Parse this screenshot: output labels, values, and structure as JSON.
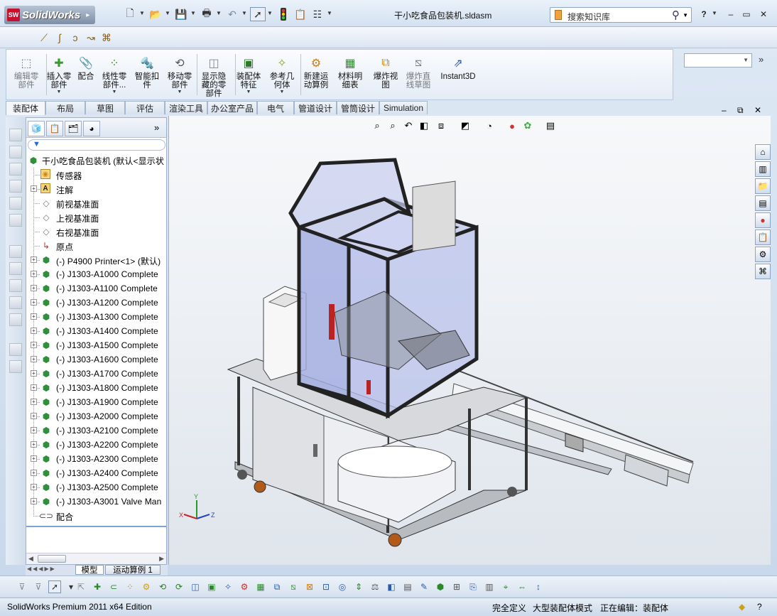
{
  "app": {
    "logo_text": "SolidWorks",
    "logo_badge": "SW",
    "document_title": "干小吃食品包装机.sldasm",
    "search_placeholder": "搜索知识库"
  },
  "quick_toolbar": {
    "icons": [
      "new-document-icon",
      "open-folder-icon",
      "save-icon",
      "print-icon",
      "undo-icon",
      "select-arrow-icon",
      "rebuild-traffic-light-icon",
      "options-icon",
      "file-properties-icon"
    ]
  },
  "window_controls": {
    "help": "?",
    "minimize": "–",
    "restore": "▭",
    "close": "✕"
  },
  "command_manager": {
    "buttons": [
      {
        "label": "编辑零\n部件",
        "icon": "edit-component-icon",
        "enabled": false
      },
      {
        "label": "插入零\n部件",
        "icon": "insert-component-icon",
        "enabled": true,
        "dropdown": true
      },
      {
        "label": "配合",
        "icon": "mate-icon",
        "enabled": true
      },
      {
        "label": "线性零\n部件...",
        "icon": "linear-pattern-icon",
        "enabled": true,
        "dropdown": true
      },
      {
        "label": "智能扣\n件",
        "icon": "smart-fastener-icon",
        "enabled": true
      },
      {
        "label": "移动零\n部件",
        "icon": "move-component-icon",
        "enabled": true,
        "dropdown": true
      },
      {
        "label": "显示隐\n藏的零\n部件",
        "icon": "show-hidden-icon",
        "enabled": true
      },
      {
        "label": "装配体\n特征",
        "icon": "assembly-feature-icon",
        "enabled": true,
        "dropdown": true
      },
      {
        "label": "参考几\n何体",
        "icon": "reference-geometry-icon",
        "enabled": true,
        "dropdown": true
      },
      {
        "label": "新建运\n动算例",
        "icon": "new-motion-study-icon",
        "enabled": true
      },
      {
        "label": "材料明\n细表",
        "icon": "bill-of-materials-icon",
        "enabled": true
      },
      {
        "label": "爆炸视\n图",
        "icon": "exploded-view-icon",
        "enabled": true
      },
      {
        "label": "爆炸直\n线草图",
        "icon": "explode-line-sketch-icon",
        "enabled": false
      },
      {
        "label": "Instant3D",
        "icon": "instant3d-icon",
        "enabled": true
      }
    ]
  },
  "tabs": [
    "装配体",
    "布局",
    "草图",
    "评估",
    "渲染工具",
    "办公室产品",
    "电气",
    "管道设计",
    "管筒设计",
    "Simulation"
  ],
  "active_tab": "装配体",
  "tree": {
    "root": "干小吃食品包装机  (默认<显示状",
    "items": [
      {
        "text": "传感器",
        "icon": "sensor-icon",
        "expandable": false
      },
      {
        "text": "注解",
        "icon": "annotation-icon",
        "expandable": true
      },
      {
        "text": "前视基准面",
        "icon": "plane-icon",
        "expandable": false
      },
      {
        "text": "上视基准面",
        "icon": "plane-icon",
        "expandable": false
      },
      {
        "text": "右视基准面",
        "icon": "plane-icon",
        "expandable": false
      },
      {
        "text": "原点",
        "icon": "origin-icon",
        "expandable": false
      },
      {
        "text": "(-) P4900 Printer<1> (默认)",
        "icon": "subassembly-icon",
        "expandable": true
      },
      {
        "text": "(-) J1303-A1000 Complete",
        "icon": "subassembly-icon",
        "expandable": true
      },
      {
        "text": "(-) J1303-A1100 Complete",
        "icon": "subassembly-icon",
        "expandable": true
      },
      {
        "text": "(-) J1303-A1200 Complete",
        "icon": "subassembly-icon",
        "expandable": true
      },
      {
        "text": "(-) J1303-A1300 Complete",
        "icon": "subassembly-icon",
        "expandable": true
      },
      {
        "text": "(-) J1303-A1400 Complete",
        "icon": "subassembly-icon",
        "expandable": true
      },
      {
        "text": "(-) J1303-A1500 Complete",
        "icon": "subassembly-icon",
        "expandable": true
      },
      {
        "text": "(-) J1303-A1600 Complete",
        "icon": "subassembly-icon",
        "expandable": true
      },
      {
        "text": "(-) J1303-A1700 Complete",
        "icon": "subassembly-icon",
        "expandable": true
      },
      {
        "text": "(-) J1303-A1800 Complete",
        "icon": "subassembly-icon",
        "expandable": true
      },
      {
        "text": "(-) J1303-A1900 Complete",
        "icon": "subassembly-icon",
        "expandable": true
      },
      {
        "text": "(-) J1303-A2000 Complete",
        "icon": "subassembly-icon",
        "expandable": true
      },
      {
        "text": "(-) J1303-A2100 Complete",
        "icon": "subassembly-icon",
        "expandable": true
      },
      {
        "text": "(-) J1303-A2200 Complete",
        "icon": "subassembly-icon",
        "expandable": true
      },
      {
        "text": "(-) J1303-A2300 Complete",
        "icon": "subassembly-icon",
        "expandable": true
      },
      {
        "text": "(-) J1303-A2400 Complete",
        "icon": "subassembly-icon",
        "expandable": true
      },
      {
        "text": "(-) J1303-A2500 Complete",
        "icon": "subassembly-icon",
        "expandable": true
      },
      {
        "text": "(-) J1303-A3001 Valve Man",
        "icon": "subassembly-icon",
        "expandable": true
      },
      {
        "text": "配合",
        "icon": "mates-folder-icon",
        "expandable": false
      }
    ]
  },
  "bottom_tabs": [
    "模型",
    "运动算例 1"
  ],
  "triad": {
    "x": "X",
    "y": "Y",
    "z": "Z"
  },
  "status": {
    "edition": "SolidWorks Premium 2011 x64 Edition",
    "definition": "完全定义",
    "mode": "大型装配体模式",
    "editing": "正在编辑：装配体"
  },
  "colors": {
    "accent": "#1f6bd1",
    "frame": "#2b2b2b",
    "glass": "#b8c4ea",
    "sheet_metal": "#c4c6ca"
  }
}
